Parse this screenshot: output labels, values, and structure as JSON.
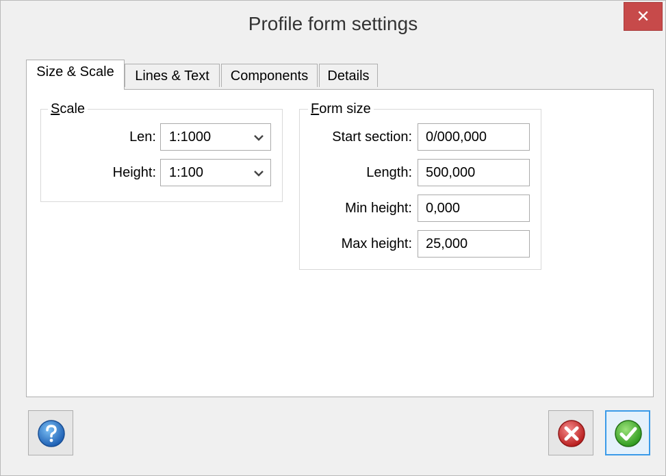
{
  "window": {
    "title": "Profile form settings",
    "close_glyph": "✕"
  },
  "tabs": [
    {
      "label": "Size & Scale",
      "active": true
    },
    {
      "label": "Lines & Text",
      "active": false
    },
    {
      "label": "Components",
      "active": false
    },
    {
      "label": "Details",
      "active": false
    }
  ],
  "scale": {
    "title_first": "S",
    "title_rest": "cale",
    "len_label": "Len:",
    "len_value": "1:1000",
    "height_label": "Height:",
    "height_value": "1:100"
  },
  "form_size": {
    "title_first": "F",
    "title_rest": "orm size",
    "start_section_label": "Start section:",
    "start_section_value": "0/000,000",
    "length_label": "Length:",
    "length_value": "500,000",
    "min_height_label": "Min height:",
    "min_height_value": "0,000",
    "max_height_label": "Max height:",
    "max_height_value": "25,000"
  },
  "buttons": {
    "help_icon": "help-icon",
    "cancel_icon": "cancel-icon",
    "ok_icon": "ok-icon"
  },
  "colors": {
    "accent": "#3a9ae8",
    "close_bg": "#c74a4a"
  }
}
